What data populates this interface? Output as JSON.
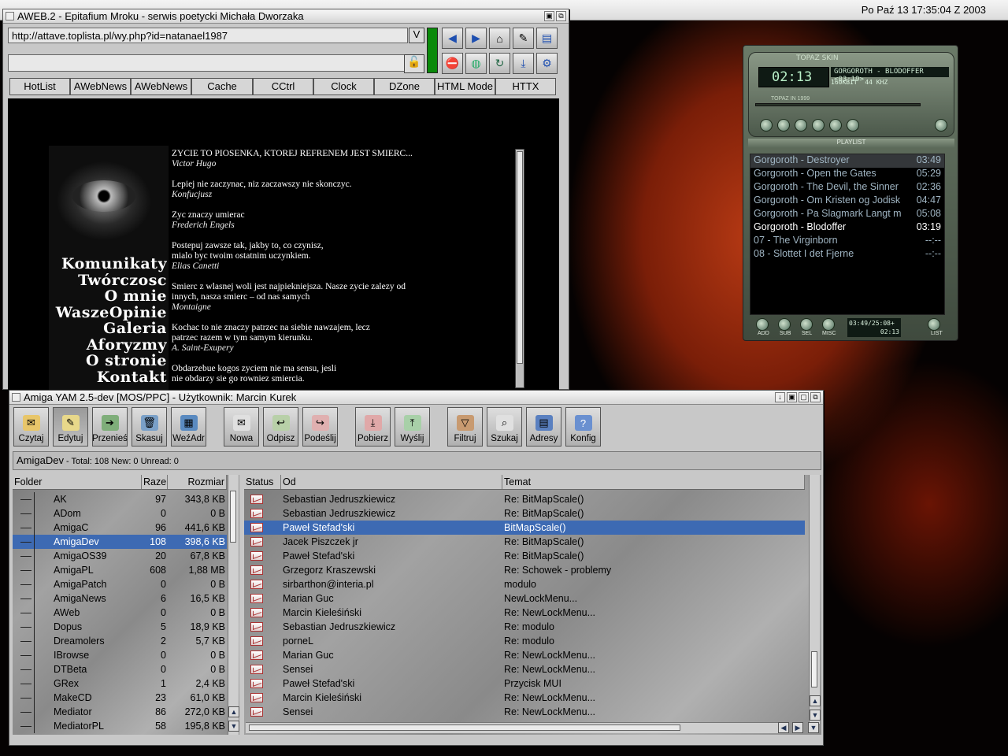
{
  "desktop": {
    "clock": "Po Paź 13 17:35:04 Z 2003"
  },
  "aweb": {
    "title": "AWEB.2 - Epitafium Mroku - serwis poetycki Michała Dworzaka",
    "url": "http://attave.toplista.pl/wy.php?id=natanael1987",
    "v_button": "V",
    "hotlist": [
      "HotList",
      "AWebNews",
      "AWebNews",
      "Cache",
      "CCtrl",
      "Clock",
      "DZone",
      "HTML Mode",
      "HTTX"
    ],
    "menu": [
      "Komunikaty",
      "Twórczosc",
      "O mnie",
      "WaszeOpinie",
      "Galeria",
      "Aforyzmy",
      "O stronie",
      "Kontakt"
    ],
    "quotes": [
      {
        "text": "ZYCIE TO PIOSENKA, KTOREJ REFRENEM JEST SMIERC...",
        "author": "Victor Hugo"
      },
      {
        "text": "Lepiej nie zaczynac, niz zaczawszy nie skonczyc.",
        "author": "Konfucjusz"
      },
      {
        "text": "Zyc znaczy umierac",
        "author": "Frederich Engels"
      },
      {
        "text": "Postepuj zawsze tak, jakby to, co czynisz, mialo byc twoim ostatnim uczynkiem.",
        "author": "Elias Canetti"
      },
      {
        "text": "Smierc z wlasnej woli jest najpiekniejsza. Nasze zycie zalezy od innych, nasza smierc – od nas samych",
        "author": "Montaigne"
      },
      {
        "text": "Kochac to nie znaczy patrzec na siebie nawzajem, lecz patrzec razem w tym samym kierunku.",
        "author": "A. Saint-Exupery"
      },
      {
        "text": "Obdarzebue kogos zyciem nie ma sensu, jesli nie obdarzy sie go rowniez smiercia.",
        "author": ""
      }
    ]
  },
  "topaz": {
    "name": "TOPAZ SKIN",
    "time": "02:13",
    "track": "GORGOROTH - BLODOFFER <03:19>",
    "bitrate": "160KBIT",
    "freq": "44 KHZ",
    "tagline": "TOPAZ IN 1999",
    "playlist_title": "PLAYLIST",
    "playlist": [
      {
        "title": "Gorgoroth - Destroyer",
        "time": "03:49"
      },
      {
        "title": "Gorgoroth - Open the Gates",
        "time": "05:29"
      },
      {
        "title": "Gorgoroth - The Devil, the Sinner",
        "time": "02:36"
      },
      {
        "title": "Gorgoroth - Om Kristen og Jodisk",
        "time": "04:47"
      },
      {
        "title": "Gorgoroth - Pa Slagmark Langt m",
        "time": "05:08"
      },
      {
        "title": "Gorgoroth - Blodoffer",
        "time": "03:19"
      },
      {
        "title": "07 - The Virginborn",
        "time": "--:--"
      },
      {
        "title": "08 - Slottet I det Fjerne",
        "time": "--:--"
      }
    ],
    "pl_total": "03:49/25:08+",
    "pl_elapsed": "02:13",
    "pl_buttons": [
      "ADD",
      "SUB",
      "SEL",
      "MISC",
      "LIST"
    ]
  },
  "yam": {
    "title": "Amiga YAM 2.5-dev [MOS/PPC]  -  Użytkownik: Marcin Kurek",
    "toolbar": [
      "Czytaj",
      "Edytuj",
      "Przenieś",
      "Skasuj",
      "WeźAdr",
      "Nowa",
      "Odpisz",
      "Podeślij",
      "Pobierz",
      "Wyślij",
      "Filtruj",
      "Szukaj",
      "Adresy",
      "Konfig"
    ],
    "folder_name": "AmigaDev",
    "folder_stats": "- Total: 108 New: 0 Unread: 0",
    "folder_headers": [
      "Folder",
      "Razem",
      "Rozmiar"
    ],
    "folders": [
      {
        "name": "AK",
        "count": "97",
        "size": "343,8 KB"
      },
      {
        "name": "ADom",
        "count": "0",
        "size": "0 B"
      },
      {
        "name": "AmigaC",
        "count": "96",
        "size": "441,6 KB"
      },
      {
        "name": "AmigaDev",
        "count": "108",
        "size": "398,6 KB"
      },
      {
        "name": "AmigaOS39",
        "count": "20",
        "size": "67,8 KB"
      },
      {
        "name": "AmigaPL",
        "count": "608",
        "size": "1,88 MB"
      },
      {
        "name": "AmigaPatch",
        "count": "0",
        "size": "0 B"
      },
      {
        "name": "AmigaNews",
        "count": "6",
        "size": "16,5 KB"
      },
      {
        "name": "AWeb",
        "count": "0",
        "size": "0 B"
      },
      {
        "name": "Dopus",
        "count": "5",
        "size": "18,9 KB"
      },
      {
        "name": "Dreamolers",
        "count": "2",
        "size": "5,7 KB"
      },
      {
        "name": "IBrowse",
        "count": "0",
        "size": "0 B"
      },
      {
        "name": "DTBeta",
        "count": "0",
        "size": "0 B"
      },
      {
        "name": "GRex",
        "count": "1",
        "size": "2,4 KB"
      },
      {
        "name": "MakeCD",
        "count": "23",
        "size": "61,0 KB"
      },
      {
        "name": "Mediator",
        "count": "86",
        "size": "272,0 KB"
      },
      {
        "name": "MediatorPL",
        "count": "58",
        "size": "195,8 KB"
      }
    ],
    "mail_headers": [
      "Status",
      "Od",
      "Temat"
    ],
    "mails": [
      {
        "from": "Sebastian Jedruszkiewicz",
        "subject": "Re: BitMapScale()"
      },
      {
        "from": "Sebastian Jedruszkiewicz",
        "subject": "Re: BitMapScale()"
      },
      {
        "from": "Paweł Stefad'ski",
        "subject": "BitMapScale()"
      },
      {
        "from": "Jacek Piszczek jr",
        "subject": "Re: BitMapScale()"
      },
      {
        "from": "Paweł Stefad'ski",
        "subject": "Re: BitMapScale()"
      },
      {
        "from": "Grzegorz Kraszewski",
        "subject": "Re: Schowek - problemy"
      },
      {
        "from": "sirbarthon@interia.pl",
        "subject": "modulo"
      },
      {
        "from": "Marian Guc",
        "subject": "NewLockMenu..."
      },
      {
        "from": "Marcin Kieleśiński",
        "subject": "Re: NewLockMenu..."
      },
      {
        "from": "Sebastian Jedruszkiewicz",
        "subject": "Re: modulo"
      },
      {
        "from": "porneL",
        "subject": "Re: modulo"
      },
      {
        "from": "Marian Guc",
        "subject": "Re: NewLockMenu..."
      },
      {
        "from": "Sensei",
        "subject": "Re: NewLockMenu..."
      },
      {
        "from": "Paweł Stefad'ski",
        "subject": "Przycisk MUI"
      },
      {
        "from": "Marcin Kieleśiński",
        "subject": "Re: NewLockMenu..."
      },
      {
        "from": "Sensei",
        "subject": "Re: NewLockMenu..."
      }
    ]
  }
}
